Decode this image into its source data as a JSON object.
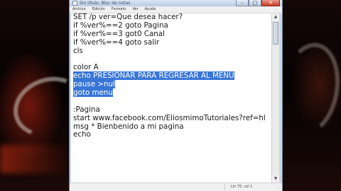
{
  "window": {
    "title": "Sin título: Bloc de notas",
    "minimize": "–",
    "maximize": "□",
    "close": "✕"
  },
  "menu": [
    "Archivo",
    "Edición",
    "Formato",
    "Ver",
    "Ayuda"
  ],
  "editor": {
    "lines": [
      "SET /p ver=Que desea hacer?",
      "if %ver%==2 goto Pagina",
      "if %ver%==3 got0 Canal",
      "if %ver%==4 goto salir",
      "cls",
      "",
      "color A",
      "echo PRESIONAR PARA REGRESAR AL MENU",
      "pause >nul",
      "goto menu",
      "",
      ":Pagina",
      "start www.facebook.com/EliosmimoTutoriales?ref=hl",
      "msg * Bienbenido a mi pagina",
      "echo"
    ],
    "selected_lines": [
      7,
      8,
      9
    ]
  },
  "status": {
    "cursor_position": "Lín 75, col 1"
  },
  "colors": {
    "selection": "#3875d7",
    "window_frame": "#c8d7ea"
  }
}
